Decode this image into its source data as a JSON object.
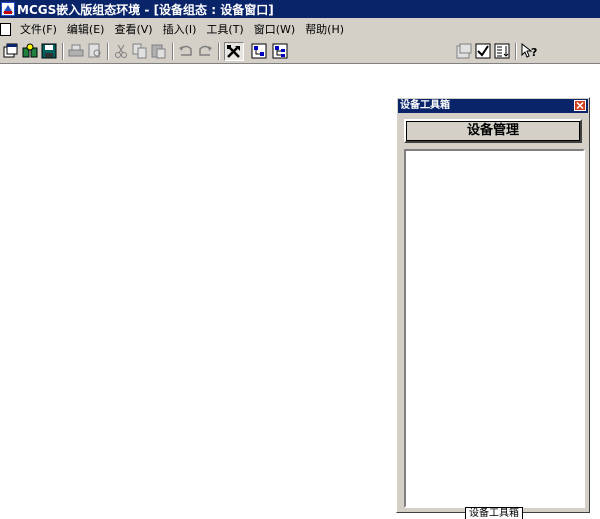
{
  "window": {
    "title": "MCGS嵌入版组态环境 - [设备组态 : 设备窗口]"
  },
  "menubar": {
    "items": [
      {
        "label": "文件(F)"
      },
      {
        "label": "编辑(E)"
      },
      {
        "label": "查看(V)"
      },
      {
        "label": "插入(I)"
      },
      {
        "label": "工具(T)"
      },
      {
        "label": "窗口(W)"
      },
      {
        "label": "帮助(H)"
      }
    ]
  },
  "toolbar": {
    "buttons": [
      "new-window-icon",
      "open-project-icon",
      "save-icon",
      "print-icon",
      "print-preview-icon",
      "cut-icon",
      "copy-icon",
      "paste-icon",
      "undo-icon",
      "redo-icon",
      "tools-icon",
      "device-tree-icon",
      "device-tree-expand-icon",
      "property-icon",
      "check-icon",
      "list-icon",
      "help-icon"
    ]
  },
  "toolbox": {
    "title": "设备工具箱",
    "button_label": "设备管理",
    "tab_label": "设备工具箱"
  },
  "colors": {
    "titlebar": "#0a246a",
    "chrome": "#d4d0c8",
    "close_button": "#d04020"
  }
}
